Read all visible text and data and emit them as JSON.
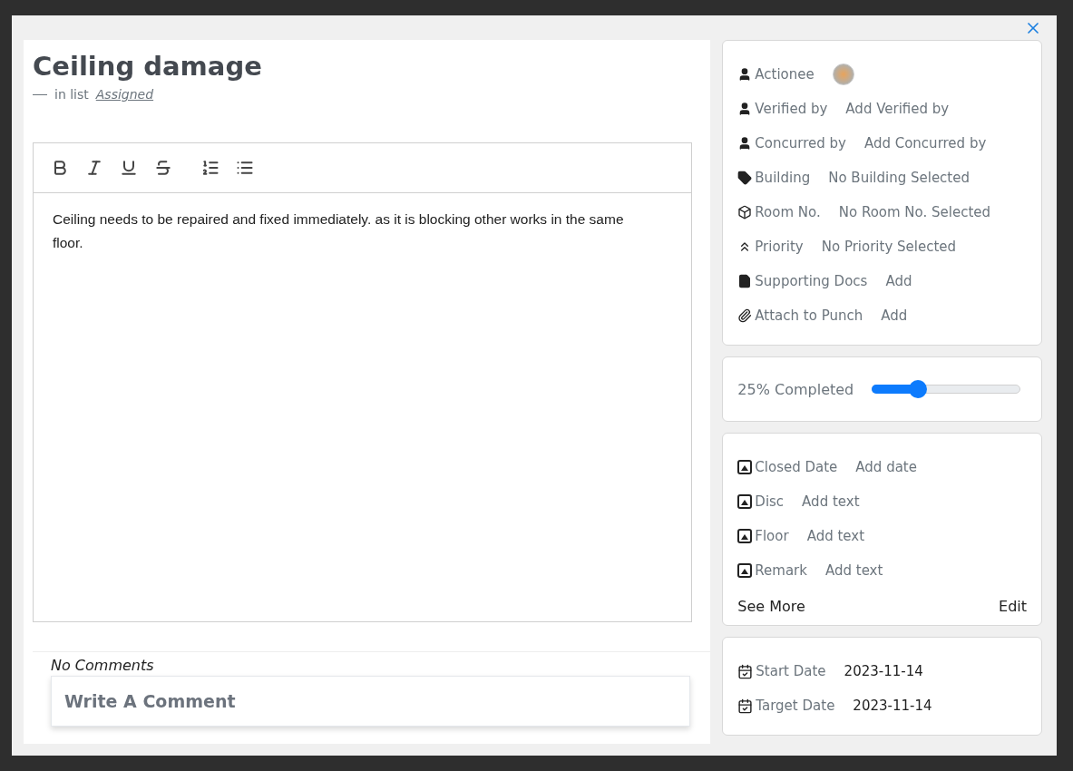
{
  "task": {
    "title": "Ceiling damage",
    "list_prefix": "in list",
    "list_name": "Assigned"
  },
  "editor": {
    "tools": [
      {
        "kind": "bold"
      },
      {
        "kind": "italic"
      },
      {
        "kind": "underline"
      },
      {
        "kind": "strike"
      },
      {
        "kind": "ordered"
      },
      {
        "kind": "bullet"
      }
    ],
    "text": "Ceiling needs to be repaired and fixed immediately. as it is blocking other works in the same floor."
  },
  "comments": {
    "empty_text": "No Comments",
    "placeholder": "Write A Comment"
  },
  "people_fields": [
    {
      "kind": "person",
      "label": "Actionee"
    },
    {
      "kind": "person",
      "label": "Verified by",
      "value": "Add Verified by"
    },
    {
      "kind": "person",
      "label": "Concurred by",
      "value": "Add Concurred by"
    },
    {
      "kind": "tag",
      "label": "Building",
      "value": "No Building Selected"
    },
    {
      "kind": "cube",
      "label": "Room No.",
      "value": "No Room No. Selected"
    },
    {
      "kind": "priority",
      "label": "Priority",
      "value": "No Priority Selected"
    },
    {
      "kind": "file",
      "label": "Supporting Docs",
      "value": "Add"
    },
    {
      "kind": "clip",
      "label": "Attach to Punch",
      "value": "Add"
    }
  ],
  "progress": {
    "label": "25% Completed",
    "level": 0.28
  },
  "custom_fields": [
    {
      "label": "Closed Date",
      "value": "Add date"
    },
    {
      "label": "Disc",
      "value": "Add text"
    },
    {
      "label": "Floor",
      "value": "Add text"
    },
    {
      "label": "Remark",
      "value": "Add text"
    }
  ],
  "custom_actions": {
    "see_more": "See More",
    "edit": "Edit"
  },
  "dates": [
    {
      "label": "Start Date",
      "value": "2023-11-14"
    },
    {
      "label": "Target Date",
      "value": "2023-11-14"
    }
  ]
}
